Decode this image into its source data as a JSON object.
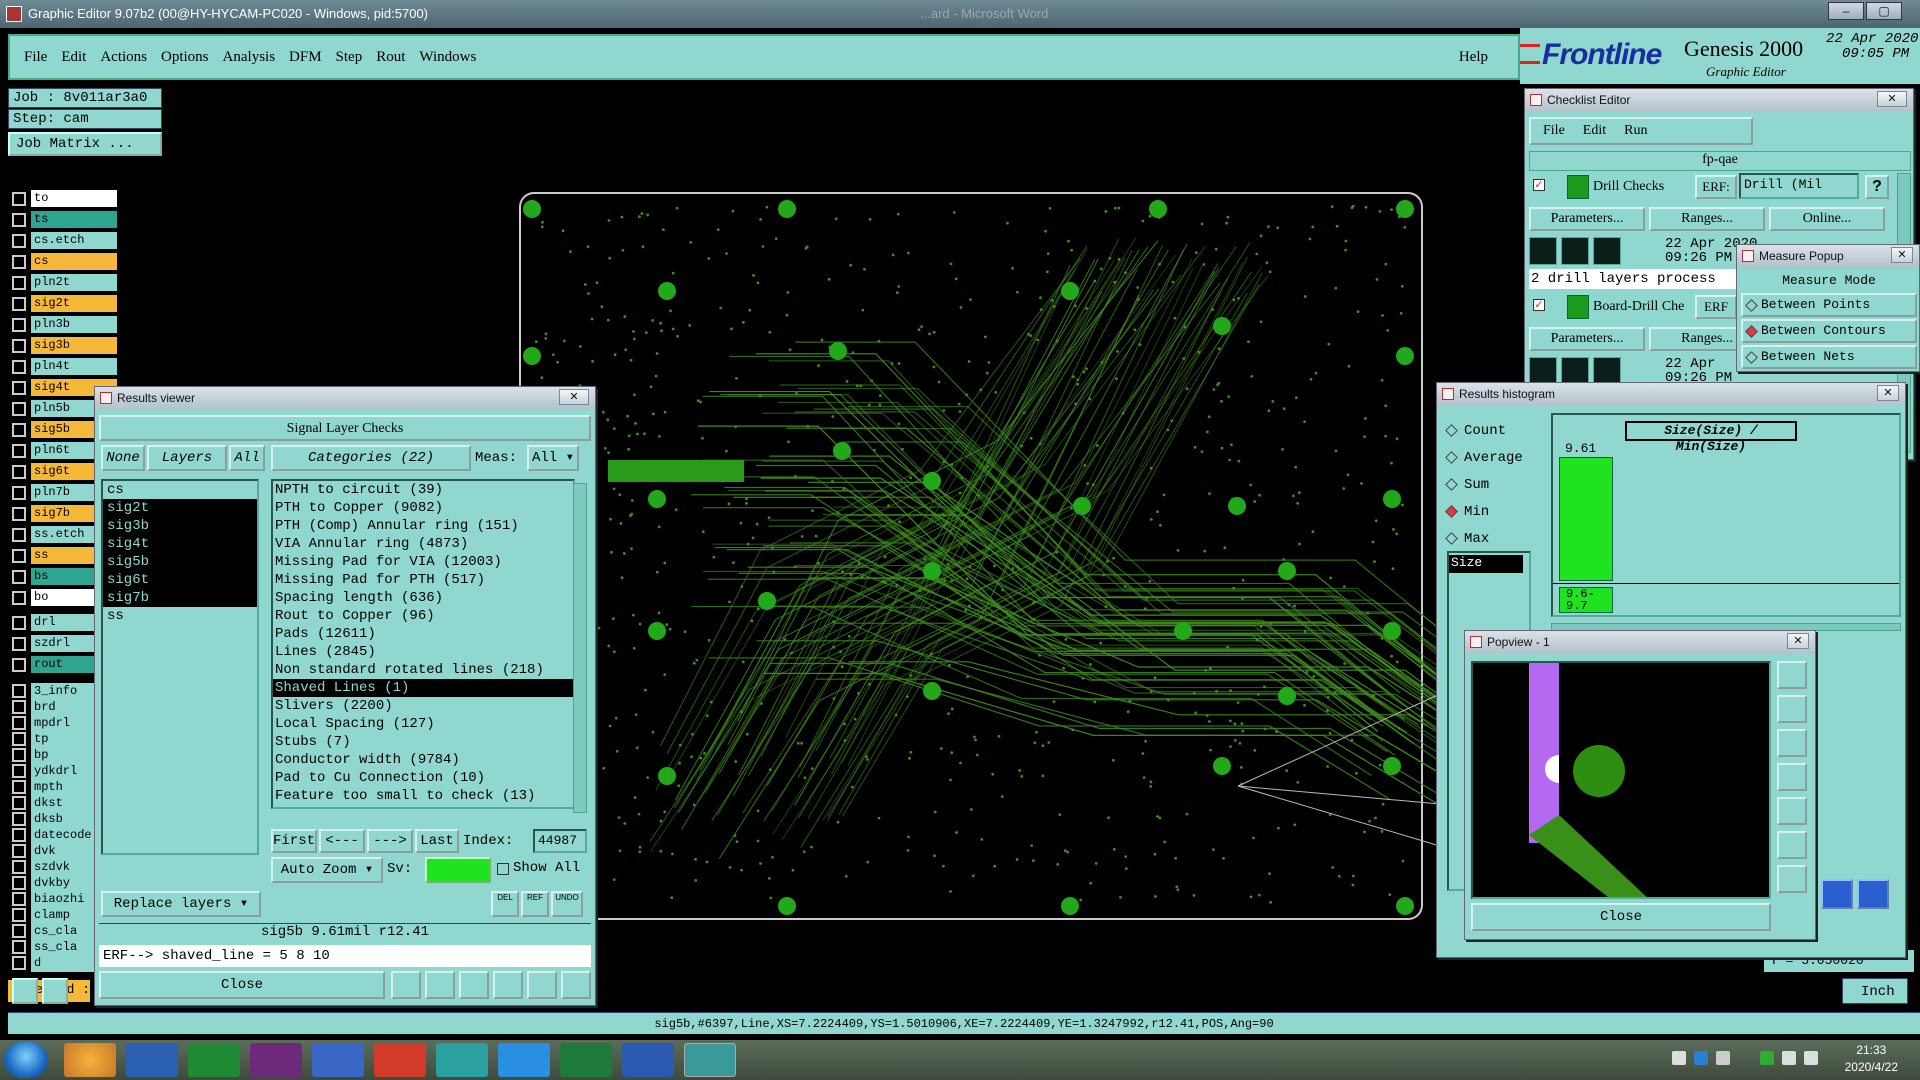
{
  "os_window": {
    "title": "Graphic Editor 9.07b2 (00@HY-HYCAM-PC020 - Windows, pid:5700)",
    "background_window_title": "...ard - Microsoft Word"
  },
  "menubar": {
    "items": [
      "File",
      "Edit",
      "Actions",
      "Options",
      "Analysis",
      "DFM",
      "Step",
      "Rout",
      "Windows"
    ],
    "help": "Help"
  },
  "brand": {
    "logo": "Frontline",
    "product": "Genesis 2000",
    "subtitle": "Graphic Editor",
    "date": "22 Apr 2020",
    "time": "09:05 PM"
  },
  "job_info": {
    "job": "Job : 8v011ar3a0",
    "step": "Step: cam",
    "job_matrix_button": "Job Matrix ..."
  },
  "layers": [
    {
      "name": "to",
      "style": "wh"
    },
    {
      "name": "ts",
      "style": "teal"
    },
    {
      "name": "cs.etch",
      "style": ""
    },
    {
      "name": "cs",
      "style": "hl"
    },
    {
      "name": "pln2t",
      "style": ""
    },
    {
      "name": "sig2t",
      "style": "hl"
    },
    {
      "name": "pln3b",
      "style": ""
    },
    {
      "name": "sig3b",
      "style": "hl"
    },
    {
      "name": "pln4t",
      "style": ""
    },
    {
      "name": "sig4t",
      "style": "hl"
    },
    {
      "name": "pln5b",
      "style": ""
    },
    {
      "name": "sig5b",
      "style": "hl"
    },
    {
      "name": "pln6t",
      "style": ""
    },
    {
      "name": "sig6t",
      "style": "hl"
    },
    {
      "name": "pln7b",
      "style": ""
    },
    {
      "name": "sig7b",
      "style": "hl"
    },
    {
      "name": "ss.etch",
      "style": ""
    },
    {
      "name": "ss",
      "style": "hl"
    },
    {
      "name": "bs",
      "style": "teal"
    },
    {
      "name": "bo",
      "style": "wh"
    },
    {
      "name": "drl",
      "style": ""
    },
    {
      "name": "szdrl",
      "style": ""
    },
    {
      "name": "rout",
      "style": "teal"
    },
    {
      "name": "3_info",
      "style": ""
    },
    {
      "name": "brd",
      "style": ""
    },
    {
      "name": "mpdrl",
      "style": ""
    },
    {
      "name": "tp",
      "style": ""
    },
    {
      "name": "bp",
      "style": ""
    },
    {
      "name": "ydkdrl",
      "style": ""
    },
    {
      "name": "mpth",
      "style": ""
    },
    {
      "name": "dkst",
      "style": ""
    },
    {
      "name": "dksb",
      "style": ""
    },
    {
      "name": "datecode",
      "style": ""
    },
    {
      "name": "dvk",
      "style": ""
    },
    {
      "name": "szdvk",
      "style": ""
    },
    {
      "name": "dvkby",
      "style": ""
    },
    {
      "name": "biaozhi",
      "style": ""
    },
    {
      "name": "clamp",
      "style": ""
    },
    {
      "name": "cs_cla",
      "style": ""
    },
    {
      "name": "ss_cla",
      "style": ""
    },
    {
      "name": "d",
      "style": ""
    }
  ],
  "selected_label": "Selected :",
  "y_readout": "Y = 5.050020\"",
  "unit": "Inch",
  "status_line": "sig5b,#6397,Line,XS=7.2224409,YS=1.5010906,XE=7.2224409,YE=1.3247992,r12.41,POS,Ang=90",
  "results_viewer": {
    "title": "Results viewer",
    "header": "Signal Layer Checks",
    "seg_none": "None",
    "seg_layers": "Layers",
    "seg_all": "All",
    "categories_label": "Categories (22)",
    "meas_label": "Meas:",
    "meas_value": "All",
    "layers": [
      "cs",
      "sig2t",
      "sig3b",
      "sig4t",
      "sig5b",
      "sig6t",
      "sig7b",
      "ss"
    ],
    "selected_layers": [
      "sig2t",
      "sig3b",
      "sig4t",
      "sig5b",
      "sig6t",
      "sig7b"
    ],
    "categories": [
      "NPTH to circuit (39)",
      "PTH to Copper (9082)",
      "PTH (Comp) Annular ring (151)",
      "VIA Annular ring (4873)",
      "Missing Pad for VIA (12003)",
      "Missing Pad for PTH (517)",
      "Spacing length (636)",
      "Rout to Copper (96)",
      "Pads (12611)",
      "Lines (2845)",
      "Non standard rotated lines (218)",
      "Shaved Lines (1)",
      "Slivers (2200)",
      "Local Spacing (127)",
      "Stubs (7)",
      "Conductor width (9784)",
      "Pad to Cu Connection (10)",
      "Feature too small to check (13)"
    ],
    "selected_category": "Shaved Lines (1)",
    "nav": {
      "first": "First",
      "prev": "<---",
      "next": "--->",
      "last": "Last",
      "index_label": "Index:",
      "index_value": "44987"
    },
    "auto_zoom": "Auto Zoom",
    "sv_label": "Sv:",
    "show_all": "Show All",
    "replace_layers": "Replace layers",
    "small_btns": [
      "DEL",
      "REF",
      "UNDO"
    ],
    "measurement": "sig5b  9.61mil  r12.41",
    "erf_line": "ERF--> shaved_line = 5 8 10",
    "close": "Close"
  },
  "checklist_editor": {
    "title": "Checklist Editor",
    "menu": [
      "File",
      "Edit",
      "Run"
    ],
    "name": "fp-qae",
    "check1": {
      "label": "Drill Checks",
      "erf_label": "ERF:",
      "erf_value": "Drill (Mil",
      "date": "22 Apr 2020",
      "time": "09:26 PM -",
      "status": "2 drill layers process"
    },
    "check2": {
      "label": "Board-Drill Che",
      "erf_label": "ERF",
      "date": "22 Apr",
      "time": "09:26 PM"
    },
    "buttons": [
      "Parameters...",
      "Ranges...",
      "Online..."
    ],
    "help_btn": "?"
  },
  "measure_popup": {
    "title": "Measure Popup",
    "header": "Measure Mode",
    "options": [
      "Between Points",
      "Between Contours",
      "Between Nets"
    ],
    "selected": "Between Contours"
  },
  "histogram": {
    "title": "Results histogram",
    "options": [
      "Count",
      "Average",
      "Sum",
      "Min",
      "Max"
    ],
    "selected": "Min",
    "field": "Size",
    "chart_title": "Size(Size) / Min(Size)",
    "bar_value": "9.61",
    "bar_range": "9.6-9.7"
  },
  "popview": {
    "title": "Popview - 1",
    "close": "Close"
  },
  "taskbar": {
    "time": "21:33",
    "date": "2020/4/22"
  },
  "colors": {
    "panel": "#8fd7cf",
    "highlight_layer": "#f5b93a",
    "pcb_trace": "#3f8f1e",
    "pad": "#23a81c"
  }
}
